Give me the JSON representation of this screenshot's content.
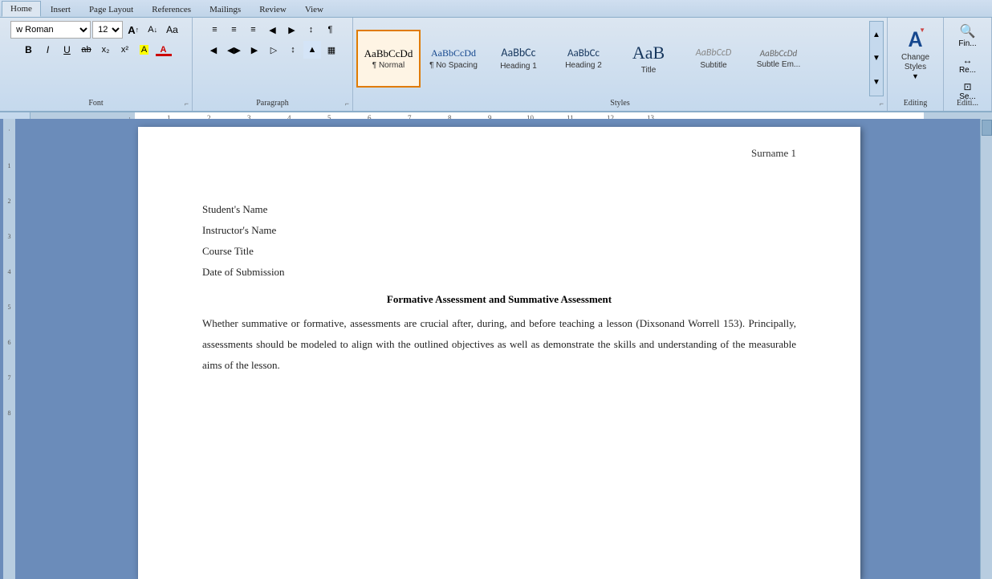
{
  "ribbon": {
    "tabs": [
      "Home",
      "Insert",
      "Page Layout",
      "References",
      "Mailings",
      "Review",
      "View"
    ],
    "active_tab": "Home",
    "font_group": {
      "label": "Font",
      "font_name": "w Roman",
      "font_size": "12",
      "buttons_row1": [
        "A↑",
        "A↓",
        "Aa"
      ],
      "buttons_row2": [
        "B",
        "I",
        "U",
        "ab",
        "x₂",
        "x²",
        "A",
        "A"
      ]
    },
    "paragraph_group": {
      "label": "Paragraph",
      "row1_btns": [
        "≡",
        "≡",
        "≡",
        "↓",
        "↕",
        "¶"
      ],
      "row2_btns": [
        "◀",
        "◀▶",
        "▶",
        "▷",
        "↕",
        "▲",
        "▦"
      ]
    },
    "styles": [
      {
        "id": "normal",
        "preview": "AaBbCcDd",
        "label": "¶ Normal",
        "active": true
      },
      {
        "id": "no-spacing",
        "preview": "AaBbCcDd",
        "label": "¶ No Spacing",
        "active": false
      },
      {
        "id": "heading1",
        "preview": "AaBbCc",
        "label": "Heading 1",
        "active": false
      },
      {
        "id": "heading2",
        "preview": "AaBbCc",
        "label": "Heading 2",
        "active": false
      },
      {
        "id": "title",
        "preview": "AaB",
        "label": "Title",
        "active": false
      },
      {
        "id": "subtitle",
        "preview": "AaBbCcD",
        "label": "Subtitle",
        "active": false
      },
      {
        "id": "subtle-em",
        "preview": "AaBbCcDd",
        "label": "Subtle Em...",
        "active": false
      }
    ],
    "change_styles": {
      "label": "Change\nStyles",
      "icon": "A"
    },
    "find_section": {
      "find_label": "Fin...",
      "replace_label": "Re...",
      "select_label": "Se..."
    }
  },
  "document": {
    "header": "Surname 1",
    "lines": [
      "Student's Name",
      "Instructor's Name",
      "Course Title",
      "Date of Submission"
    ],
    "title": "Formative  Assessment and  Summative  Assessment",
    "body_paragraphs": [
      "Whether summative or formative, assessments are crucial after, during, and before teaching a lesson (Dixsonand Worrell 153). Principally, assessments should be modeled to align with the outlined objectives as well as demonstrate the skills and understanding of the measurable aims of the lesson."
    ]
  }
}
